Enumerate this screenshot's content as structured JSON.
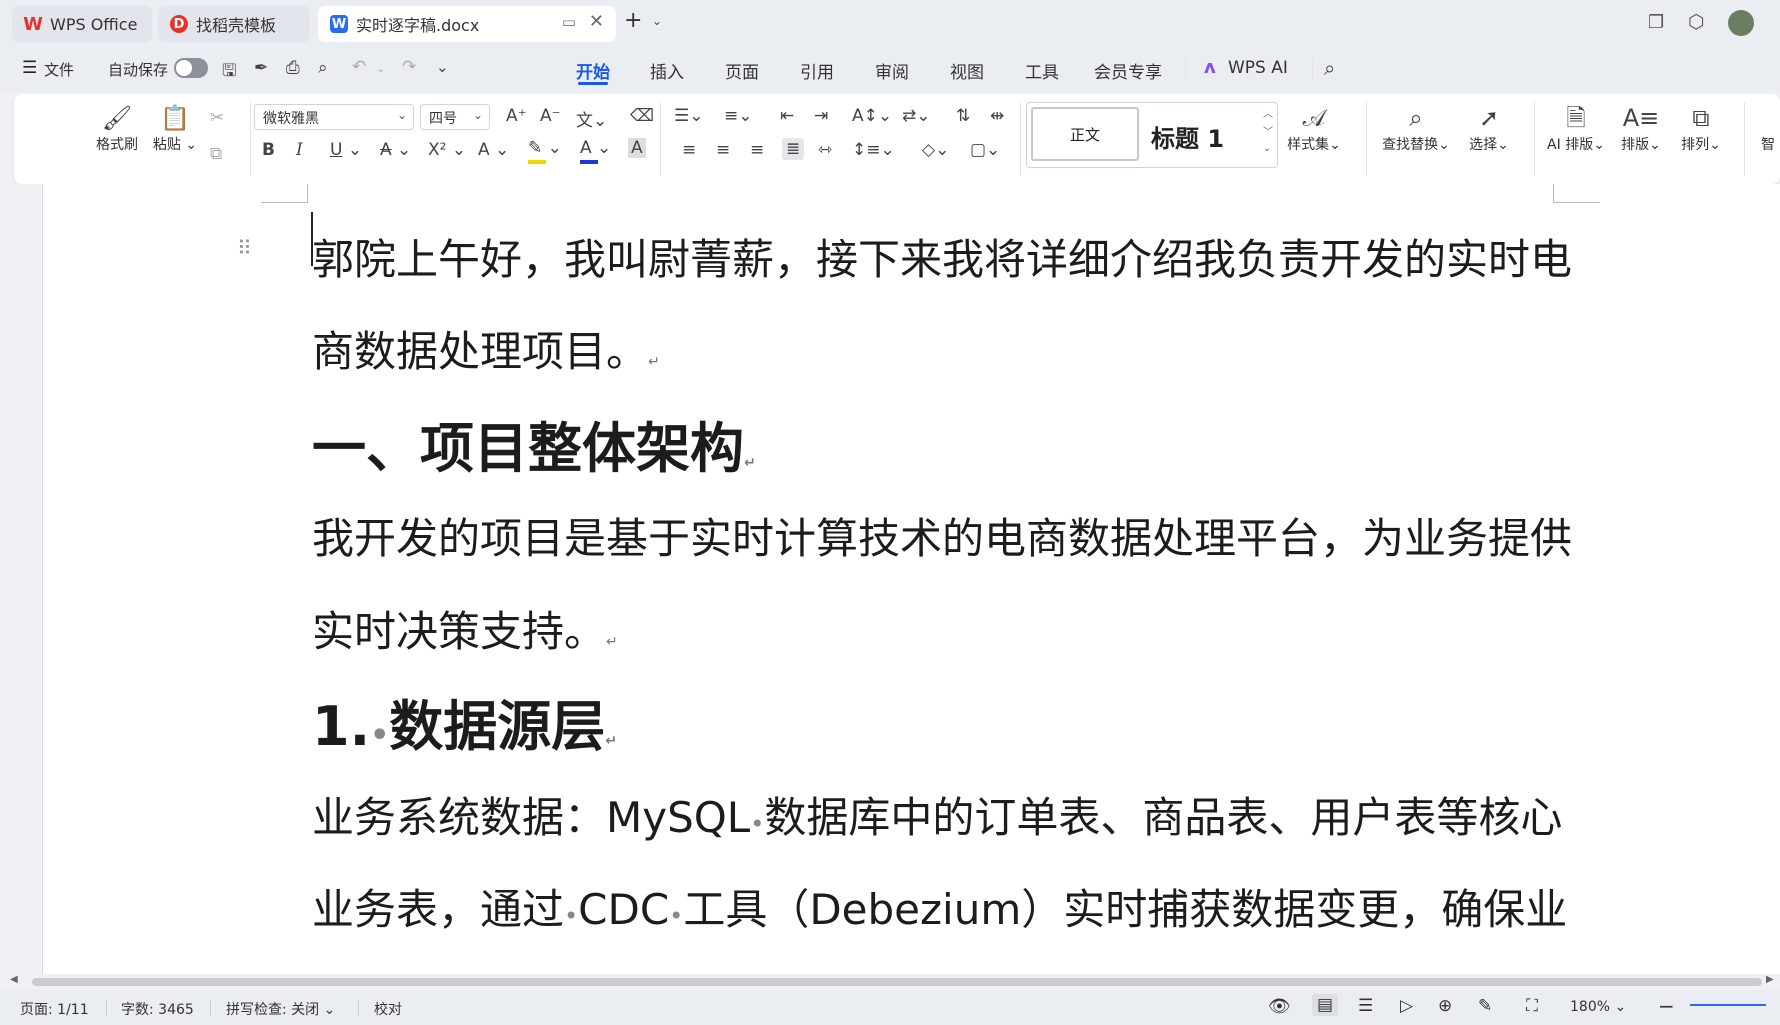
{
  "tabs": [
    {
      "label": "WPS Office",
      "icon": "wps-logo-icon"
    },
    {
      "label": "找稻壳模板",
      "icon": "docer-template-icon"
    },
    {
      "label": "实时逐字稿.docx",
      "icon": "word-doc-icon"
    }
  ],
  "menu": {
    "file_label": "文件",
    "autosave_label": "自动保存",
    "tabs": [
      "开始",
      "插入",
      "页面",
      "引用",
      "审阅",
      "视图",
      "工具",
      "会员专享"
    ],
    "active_tab": "开始",
    "ai_label": "WPS AI"
  },
  "ribbon": {
    "format_painter": "格式刷",
    "paste": "粘贴",
    "font_name": "微软雅黑",
    "font_size": "四号",
    "style_normal": "正文",
    "style_heading1": "标题 1",
    "style_set": "样式集",
    "find_replace": "查找替换",
    "select": "选择",
    "ai_layout": "AI 排版",
    "layout": "排版",
    "arrange": "排列",
    "smart": "智",
    "bold": "B",
    "italic": "I",
    "underline": "U",
    "strike": "A",
    "superscript": "X²",
    "font_color": "A",
    "highlight_color": "#f2d600",
    "font_color_value": "#1a3ad6"
  },
  "document": {
    "lines": [
      {
        "text": "郭院上午好，我叫尉菁薪，接下来我将详细介绍我负责开发的实时电",
        "type": "body"
      },
      {
        "text": "商数据处理项目。",
        "type": "body"
      },
      {
        "text": "一、项目整体架构",
        "type": "h1"
      },
      {
        "text": "我开发的项目是基于实时计算技术的电商数据处理平台，为业务提供",
        "type": "body"
      },
      {
        "text": "实时决策支持。",
        "type": "body"
      },
      {
        "text": "1.",
        "type": "h1"
      },
      {
        "text": "数据源层",
        "type": "h1"
      },
      {
        "text": "业务系统数据：MySQL",
        "type": "body"
      },
      {
        "text": "数据库中的订单表、商品表、用户表等核心",
        "type": "body"
      },
      {
        "text": "业务表，通过",
        "type": "body"
      },
      {
        "text": "CDC",
        "type": "body"
      },
      {
        "text": "工具（Debezium）实时捕获数据变更，确保业",
        "type": "body"
      }
    ]
  },
  "status": {
    "page": "页面: 1/11",
    "words": "字数: 3465",
    "spellcheck": "拼写检查: 关闭",
    "proofread": "校对",
    "zoom": "180%"
  }
}
